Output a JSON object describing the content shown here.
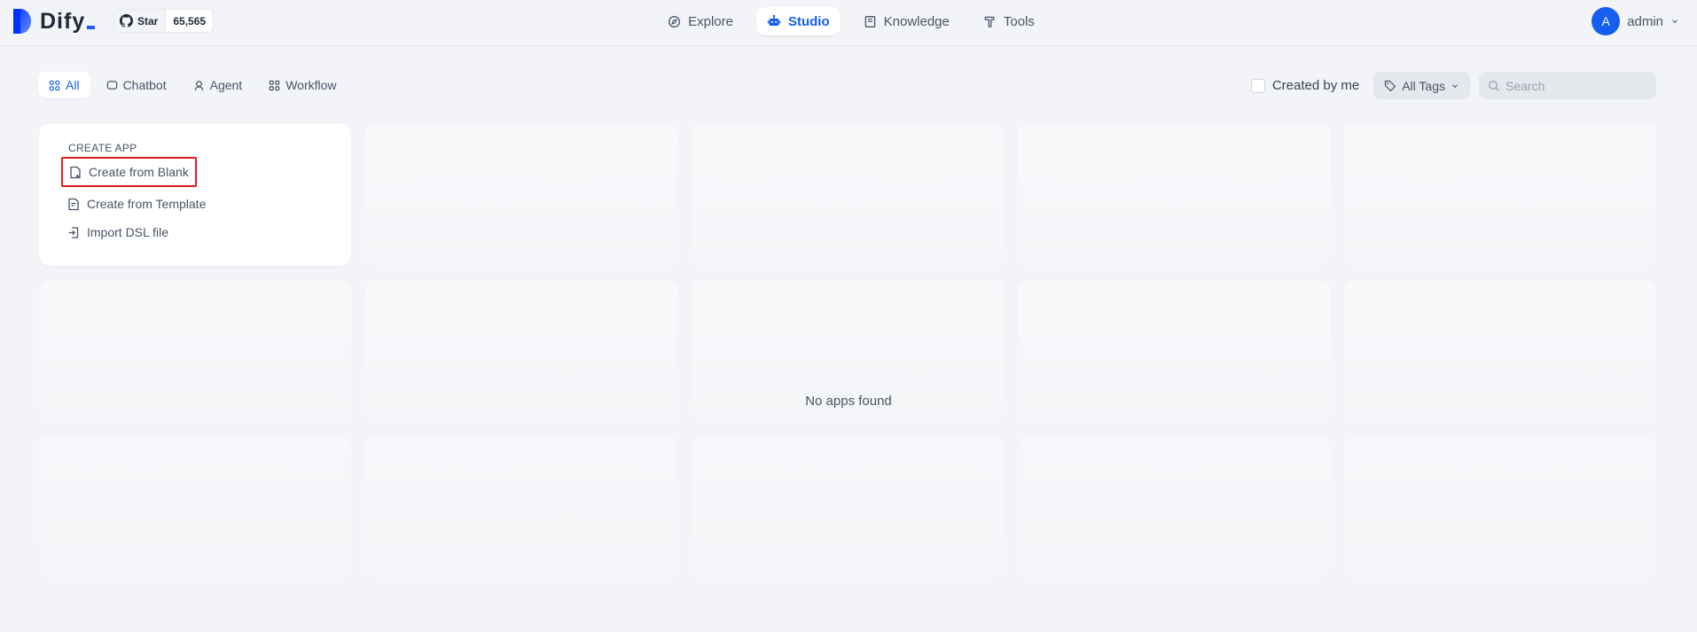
{
  "brand": {
    "name": "Dify",
    "accent": "#155eef"
  },
  "github": {
    "star_label": "Star",
    "count": "65,565"
  },
  "nav": [
    {
      "label": "Explore",
      "icon": "compass-icon",
      "active": false
    },
    {
      "label": "Studio",
      "icon": "robot-icon",
      "active": true
    },
    {
      "label": "Knowledge",
      "icon": "book-icon",
      "active": false
    },
    {
      "label": "Tools",
      "icon": "hammer-icon",
      "active": false
    }
  ],
  "user": {
    "avatar_letter": "A",
    "name": "admin"
  },
  "tabs": [
    {
      "label": "All",
      "icon": "grid-icon",
      "active": true
    },
    {
      "label": "Chatbot",
      "icon": "chat-icon",
      "active": false
    },
    {
      "label": "Agent",
      "icon": "agent-icon",
      "active": false
    },
    {
      "label": "Workflow",
      "icon": "workflow-icon",
      "active": false
    }
  ],
  "filters": {
    "created_by_me": "Created by me",
    "tags_label": "All Tags",
    "search_placeholder": "Search"
  },
  "create_app": {
    "title": "CREATE APP",
    "items": [
      {
        "label": "Create from Blank",
        "icon": "file-plus-icon"
      },
      {
        "label": "Create from Template",
        "icon": "template-icon"
      },
      {
        "label": "Import DSL file",
        "icon": "import-icon"
      }
    ]
  },
  "empty_state": "No apps found"
}
